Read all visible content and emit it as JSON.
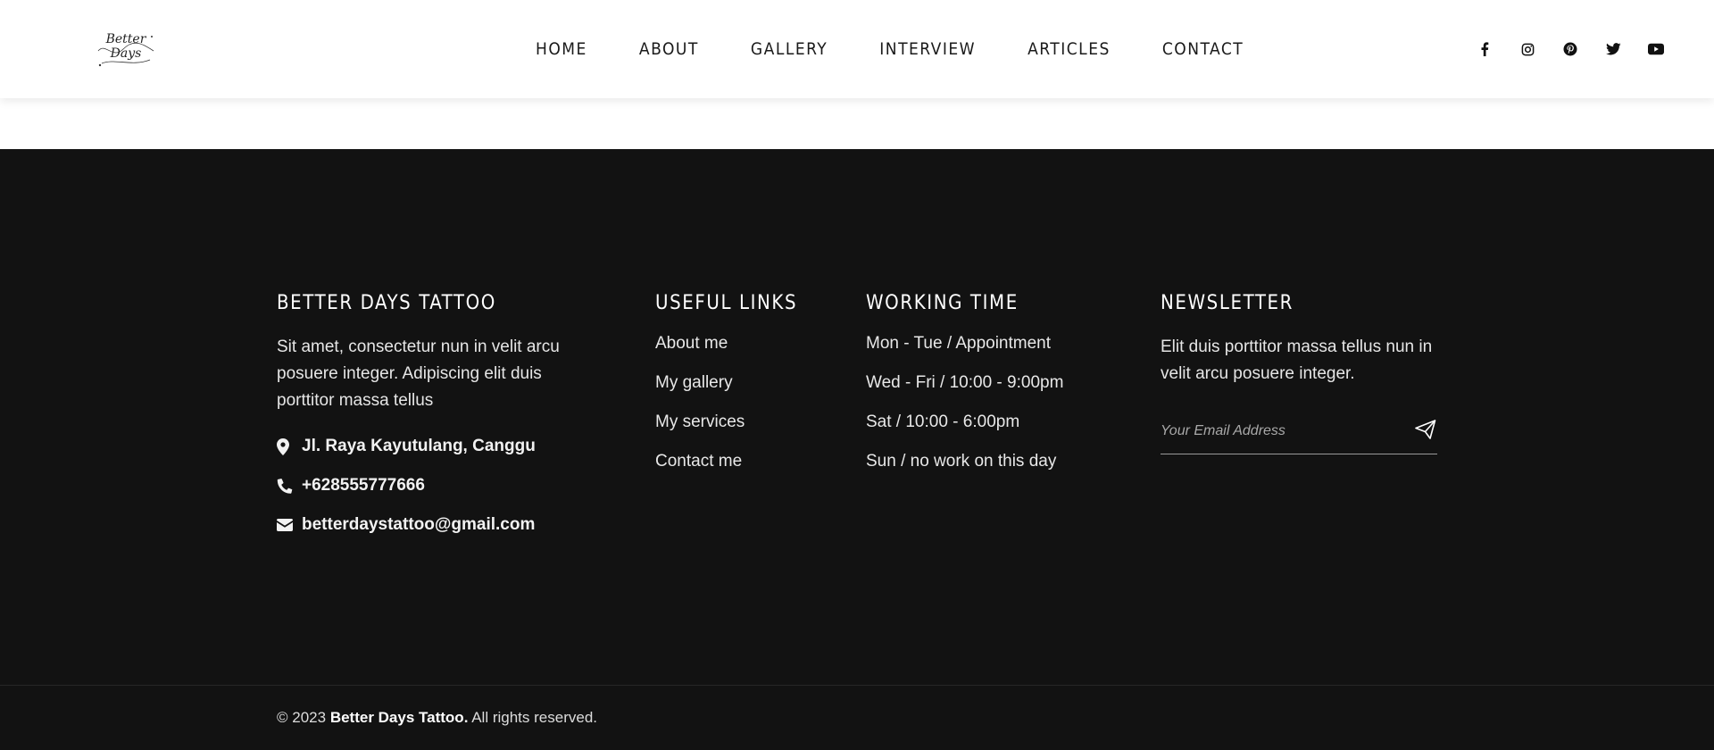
{
  "header": {
    "logo_text_line1": "Better",
    "logo_text_line2": "Days",
    "nav": [
      "HOME",
      "ABOUT",
      "GALLERY",
      "INTERVIEW",
      "ARTICLES",
      "CONTACT"
    ],
    "social_icons": [
      "facebook-icon",
      "instagram-icon",
      "pinterest-icon",
      "twitter-icon",
      "youtube-icon"
    ]
  },
  "footer": {
    "about": {
      "title": "BETTER DAYS TATTOO",
      "description": "Sit amet, consectetur nun in velit arcu posuere integer. Adipiscing elit duis porttitor massa tellus",
      "address": "Jl. Raya Kayutulang, Canggu",
      "phone": "+628555777666",
      "email": "betterdaystattoo@gmail.com"
    },
    "links": {
      "title": "USEFUL LINKS",
      "items": [
        "About me",
        "My gallery",
        "My services",
        "Contact me"
      ]
    },
    "working": {
      "title": "WORKING TIME",
      "items": [
        "Mon - Tue / Appointment",
        "Wed - Fri / 10:00 - 9:00pm",
        "Sat / 10:00 - 6:00pm",
        "Sun / no work on this day"
      ]
    },
    "newsletter": {
      "title": "NEWSLETTER",
      "description": "Elit duis porttitor massa tellus nun in velit arcu posuere integer.",
      "placeholder": "Your Email Address"
    },
    "copyright": {
      "prefix": "© 2023",
      "brand": "Better Days Tattoo.",
      "suffix": "All rights reserved."
    }
  },
  "colors": {
    "footer_bg": "#121212",
    "header_bg": "#ffffff",
    "text_light": "#e8e8e8"
  }
}
